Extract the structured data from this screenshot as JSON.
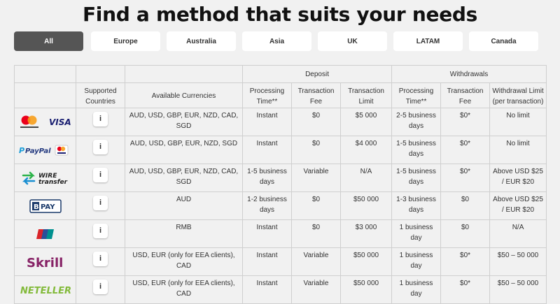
{
  "page_title": "Find a method that suits your needs",
  "tabs": [
    {
      "label": "All",
      "active": true
    },
    {
      "label": "Europe",
      "active": false
    },
    {
      "label": "Australia",
      "active": false
    },
    {
      "label": "Asia",
      "active": false
    },
    {
      "label": "UK",
      "active": false
    },
    {
      "label": "LATAM",
      "active": false
    },
    {
      "label": "Canada",
      "active": false
    }
  ],
  "table": {
    "group_headers": {
      "deposit": "Deposit",
      "withdrawals": "Withdrawals"
    },
    "columns": {
      "countries": "Supported Countries",
      "currencies": "Available Currencies",
      "dep_time": "Processing Time**",
      "dep_fee": "Transaction Fee",
      "dep_limit": "Transaction Limit",
      "wd_time": "Processing Time**",
      "wd_fee": "Transaction Fee",
      "wd_limit": "Withdrawal Limit (per transaction)"
    },
    "info_label": "i",
    "rows": [
      {
        "logo": "mastercard-visa-logo",
        "currencies": "AUD, USD, GBP, EUR, NZD, CAD, SGD",
        "dep_time": "Instant",
        "dep_fee": "$0",
        "dep_limit": "$5 000",
        "wd_time": "2-5 business days",
        "wd_fee": "$0*",
        "wd_limit": "No limit"
      },
      {
        "logo": "paypal-visa-logo",
        "currencies": "AUD, USD, GBP, EUR, NZD, SGD",
        "dep_time": "Instant",
        "dep_fee": "$0",
        "dep_limit": "$4 000",
        "wd_time": "1-5 business days",
        "wd_fee": "$0*",
        "wd_limit": "No limit"
      },
      {
        "logo": "wire-transfer-logo",
        "currencies": "AUD, USD, GBP, EUR, NZD, CAD, SGD",
        "dep_time": "1-5 business days",
        "dep_fee": "Variable",
        "dep_limit": "N/A",
        "wd_time": "1-5 business days",
        "wd_fee": "$0*",
        "wd_limit": "Above USD $25 / EUR $20"
      },
      {
        "logo": "bpay-logo",
        "currencies": "AUD",
        "dep_time": "1-2 business days",
        "dep_fee": "$0",
        "dep_limit": "$50 000",
        "wd_time": "1-3 business days",
        "wd_fee": "$0",
        "wd_limit": "Above USD $25 / EUR $20"
      },
      {
        "logo": "unionpay-logo",
        "currencies": "RMB",
        "dep_time": "Instant",
        "dep_fee": "$0",
        "dep_limit": "$3 000",
        "wd_time": "1 business day",
        "wd_fee": "$0",
        "wd_limit": "N/A"
      },
      {
        "logo": "skrill-logo",
        "currencies": "USD, EUR (only for EEA clients), CAD",
        "dep_time": "Instant",
        "dep_fee": "Variable",
        "dep_limit": "$50 000",
        "wd_time": "1 business day",
        "wd_fee": "$0*",
        "wd_limit": "$50 – 50 000"
      },
      {
        "logo": "neteller-logo",
        "currencies": "USD, EUR (only for EEA clients), CAD",
        "dep_time": "Instant",
        "dep_fee": "Variable",
        "dep_limit": "$50 000",
        "wd_time": "1 business day",
        "wd_fee": "$0*",
        "wd_limit": "$50 – 50 000"
      }
    ]
  },
  "colors": {
    "background": "#f1f1f1",
    "active_tab": "#555555",
    "mastercard_red": "#eb001b",
    "mastercard_orange": "#f79e1b",
    "visa_blue": "#1a1f71",
    "paypal_dark": "#253b80",
    "paypal_light": "#179bd7",
    "wire_green": "#2db34a",
    "wire_blue": "#1a8fd1",
    "bpay_blue": "#1b3a6b",
    "unionpay_blue": "#2a4f9a",
    "skrill_purple": "#862165",
    "neteller_green": "#83ba3b"
  }
}
